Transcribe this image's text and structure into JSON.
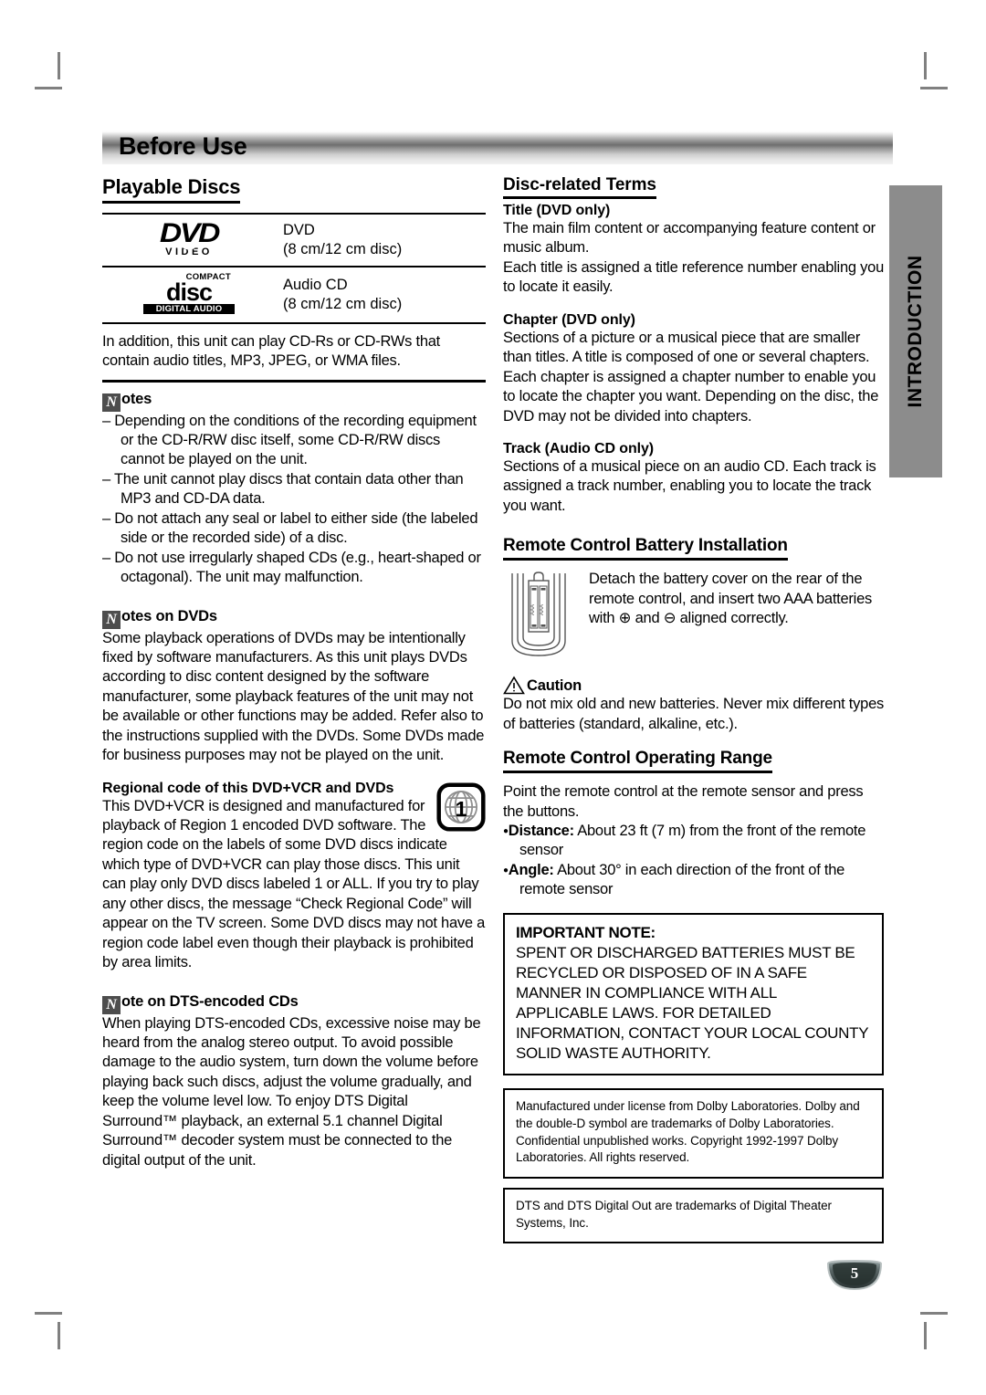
{
  "page": {
    "header_title": "Before Use",
    "page_number": "5",
    "side_tab_label": "INTRODUCTION"
  },
  "left_column": {
    "playable_discs": {
      "heading": "Playable Discs",
      "rows": [
        {
          "icon": "dvd-video-logo",
          "icon_text": {
            "main": "DVD",
            "sub": "VIDEO"
          },
          "name": "DVD",
          "detail": "(8 cm/12 cm disc)"
        },
        {
          "icon": "compact-disc-digital-audio-logo",
          "icon_text": {
            "top": "COMPACT",
            "main": "disc",
            "bottom": "DIGITAL AUDIO"
          },
          "name": "Audio CD",
          "detail": "(8 cm/12 cm disc)"
        }
      ],
      "addendum": "In addition, this unit can play CD-Rs or CD-RWs that contain audio titles, MP3, JPEG, or WMA files."
    },
    "notes": {
      "badge_letter": "N",
      "heading_rest": "otes",
      "items": [
        "Depending on the conditions of the recording equipment or the CD-R/RW disc itself, some CD-R/RW discs cannot be played on the unit.",
        "The unit cannot play discs that contain data other than MP3 and CD-DA data.",
        "Do not attach any seal or label to either side (the labeled side or the recorded side) of a disc.",
        "Do not use irregularly shaped CDs (e.g., heart-shaped or octagonal). The unit may malfunction."
      ]
    },
    "notes_on_dvds": {
      "badge_letter": "N",
      "heading_rest": "otes on DVDs",
      "body": "Some playback operations of DVDs may be intentionally fixed by software manufacturers. As this unit plays DVDs according to disc content designed by the software manufacturer, some playback features of the unit may not be available or other functions may be added. Refer also to the instructions supplied with the DVDs. Some DVDs made for business purposes may not be played on the unit."
    },
    "regional_code": {
      "heading": "Regional code of this DVD+VCR and DVDs",
      "icon": "region-globe-icon",
      "icon_number": "1",
      "body": "This DVD+VCR is designed and manufactured for playback of Region 1 encoded DVD software. The region code on the labels of some DVD discs indicate which type of DVD+VCR can play those discs. This unit can play only DVD discs labeled 1 or ALL. If you try to play any other discs, the message “Check Regional Code” will appear on the TV screen. Some DVD discs may not have a region code label even though their playback is prohibited by area limits."
    },
    "note_dts": {
      "badge_letter": "N",
      "heading_rest": "ote on DTS-encoded CDs",
      "body": "When playing DTS-encoded CDs, excessive noise may be heard from the analog stereo output. To avoid possible damage to the audio system, turn down the volume before playing back such discs, adjust the volume gradually, and keep the volume level low. To enjoy DTS Digital Surround™ playback, an external 5.1 channel Digital Surround™ decoder system must be connected to the digital output of the unit."
    }
  },
  "right_column": {
    "disc_related_terms": {
      "heading": "Disc-related Terms",
      "entries": [
        {
          "title": "Title (DVD only)",
          "body": "The main film content or accompanying feature content or music album.\nEach title is assigned a title reference number enabling you to locate it easily."
        },
        {
          "title": "Chapter (DVD only)",
          "body": "Sections of a picture or a musical piece that are smaller than titles. A title is composed of one or several chapters. Each chapter is assigned a chapter number to enable you to locate the chapter you want. Depending on the disc, the DVD may not be divided into chapters."
        },
        {
          "title": "Track (Audio CD only)",
          "body": "Sections of a musical piece on an audio CD. Each track is assigned a track number, enabling you to locate the track you want."
        }
      ]
    },
    "battery_installation": {
      "heading": "Remote Control Battery Installation",
      "icon": "remote-control-battery-figure",
      "body": "Detach the battery cover on the rear of the remote control, and insert two AAA batteries with ⊕ and ⊖ aligned correctly."
    },
    "caution": {
      "icon": "warning-triangle-icon",
      "heading": "Caution",
      "body": "Do not mix old and new batteries. Never mix different types of batteries (standard, alkaline, etc.)."
    },
    "operating_range": {
      "heading": "Remote Control Operating Range",
      "intro": "Point the remote control at the remote sensor and press the buttons.",
      "items": [
        {
          "label": "Distance:",
          "text": " About 23 ft (7 m) from the front of the remote sensor"
        },
        {
          "label": "Angle:",
          "text": "  About 30° in each direction of the front of the remote sensor"
        }
      ]
    },
    "important_note": {
      "title": "IMPORTANT NOTE:",
      "body": "SPENT OR DISCHARGED BATTERIES MUST BE RECYCLED OR DISPOSED OF IN A SAFE MANNER IN COMPLIANCE WITH ALL APPLICABLE LAWS. FOR DETAILED INFORMATION, CONTACT YOUR LOCAL COUNTY SOLID WASTE AUTHORITY."
    },
    "dolby_notice": "Manufactured under license from Dolby Laboratories. Dolby and the double-D symbol are trademarks of Dolby Laboratories. Confidential unpublished works. Copyright 1992-1997 Dolby Laboratories. All rights reserved.",
    "dts_notice": "DTS and DTS Digital Out are trademarks of Digital Theater Systems, Inc."
  }
}
